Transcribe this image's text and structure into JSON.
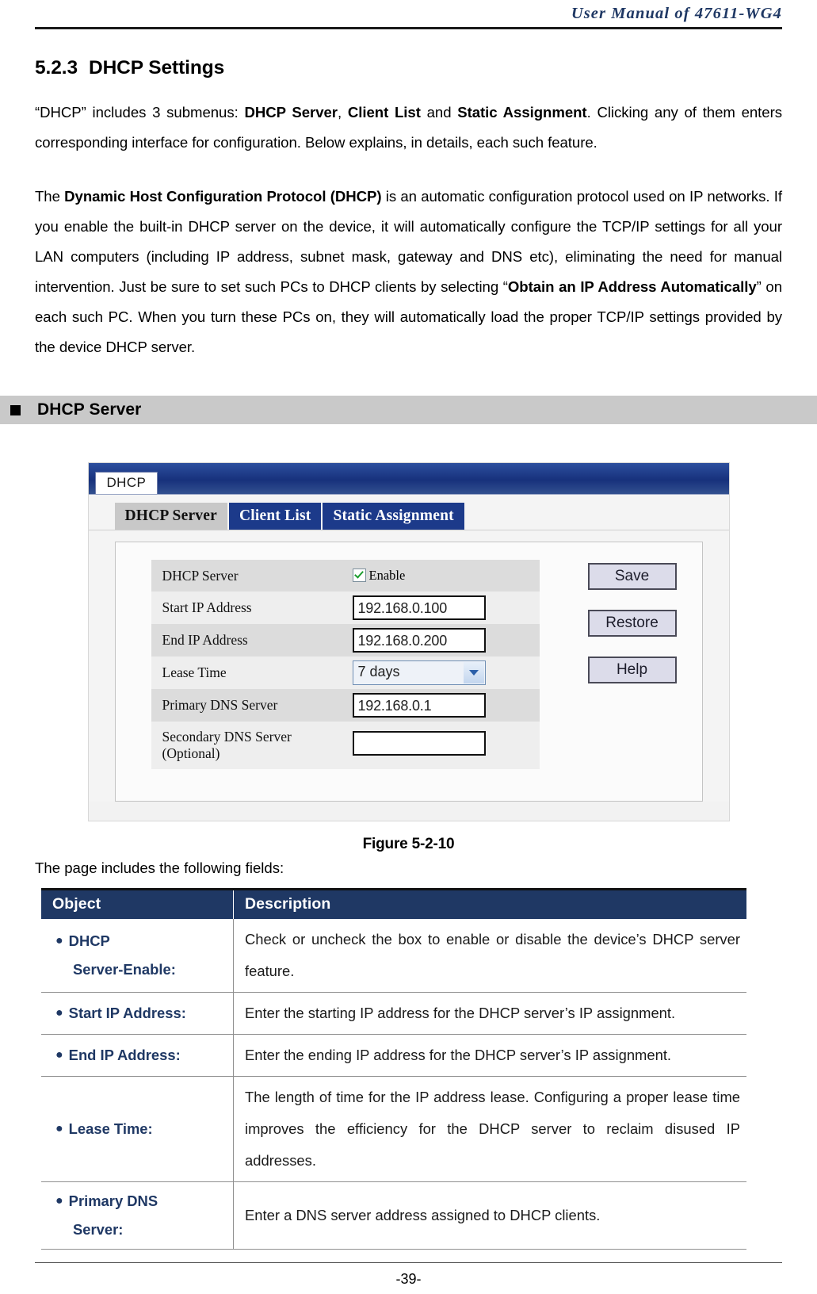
{
  "header": {
    "running_title": "User Manual of 47611-WG4"
  },
  "section": {
    "number": "5.2.3",
    "title": "DHCP Settings"
  },
  "paragraphs": {
    "p1": {
      "seg1": "“DHCP” includes 3 submenus: ",
      "b1": "DHCP Server",
      "seg2": ", ",
      "b2": "Client List",
      "seg3": " and ",
      "b3": "Static Assignment",
      "seg4": ". Clicking any of them enters corresponding interface for configuration. Below explains, in details, each such feature."
    },
    "p2": {
      "seg1": "The ",
      "b1": "Dynamic Host Configuration Protocol (DHCP)",
      "seg2": " is an automatic configuration protocol used on IP networks. If you enable the built-in DHCP server on the device, it will automatically configure the TCP/IP settings for all your LAN computers (including IP address, subnet mask, gateway and DNS etc), eliminating the need for manual intervention. Just be sure to set such PCs to DHCP clients by selecting “",
      "b2": "Obtain an IP Address Automatically",
      "seg3": "” on each such PC. When you turn these PCs on, they will automatically load the proper TCP/IP settings provided by the device DHCP server."
    }
  },
  "bullet_bar": {
    "label": "DHCP Server"
  },
  "screenshot": {
    "window_tab": "DHCP",
    "tabs": [
      {
        "label": "DHCP Server",
        "state": "active"
      },
      {
        "label": "Client List",
        "state": "inactive"
      },
      {
        "label": "Static Assignment",
        "state": "inactive"
      }
    ],
    "fields": [
      {
        "label": "DHCP Server",
        "type": "checkbox",
        "checked": true,
        "checkbox_label": "Enable"
      },
      {
        "label": "Start IP Address",
        "type": "text",
        "value": "192.168.0.100"
      },
      {
        "label": "End IP Address",
        "type": "text",
        "value": "192.168.0.200"
      },
      {
        "label": "Lease Time",
        "type": "select",
        "value": "7 days"
      },
      {
        "label": "Primary DNS Server",
        "type": "text",
        "value": "192.168.0.1"
      },
      {
        "label": "Secondary DNS Server (Optional)",
        "label_line1": "Secondary DNS Server",
        "label_line2": "(Optional)",
        "type": "text",
        "value": ""
      }
    ],
    "buttons": [
      {
        "label": "Save"
      },
      {
        "label": "Restore"
      },
      {
        "label": "Help"
      }
    ],
    "colors": {
      "titlebar": "#17317c",
      "tab_inactive": "#1c3a8a",
      "tab_active": "#c8c8c8",
      "check": "#1c9c2e"
    }
  },
  "figure": {
    "caption": "Figure 5-2-10"
  },
  "lead_in": "The page includes the following fields:",
  "table": {
    "headers": {
      "object": "Object",
      "description": "Description"
    },
    "rows": [
      {
        "object_line1": "DHCP",
        "object_line2": "Server-Enable:",
        "description": "Check or uncheck the box to enable or disable the device’s DHCP server feature."
      },
      {
        "object_line1": "Start IP Address:",
        "object_line2": "",
        "description": "Enter the starting IP address for the DHCP server’s IP assignment."
      },
      {
        "object_line1": "End IP Address:",
        "object_line2": "",
        "description": "Enter the ending IP address for the DHCP server’s IP assignment."
      },
      {
        "object_line1": "Lease Time:",
        "object_line2": "",
        "description": "The length of time for the IP address lease. Configuring a proper lease time improves the efficiency for the DHCP server to reclaim disused IP addresses."
      },
      {
        "object_line1": "Primary DNS",
        "object_line2": "Server:",
        "description": "Enter a DNS server address assigned to DHCP clients."
      }
    ]
  },
  "footer": {
    "page_number": "-39-"
  }
}
